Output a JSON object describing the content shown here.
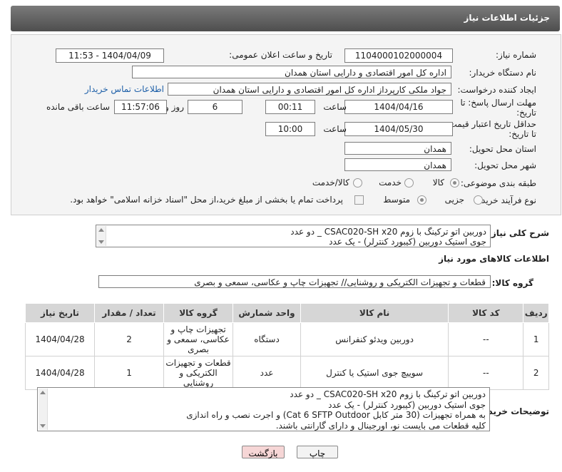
{
  "header": {
    "title": "جزئیات اطلاعات نیاز"
  },
  "form": {
    "need_number_label": "شماره نیاز:",
    "need_number": "1104000102000004",
    "announce_label": "تاریخ و ساعت اعلان عمومی:",
    "announce_value": "1404/04/09 - 11:53",
    "buyer_label": "نام دستگاه خریدار:",
    "buyer_value": "اداره کل امور اقتصادی و دارایی استان همدان",
    "creator_label": "ایجاد کننده درخواست:",
    "creator_value": "جواد ملکی کارپرداز اداره کل امور اقتصادی و دارایی استان همدان",
    "contact_link": "اطلاعات تماس خریدار",
    "deadline_label": "مهلت ارسال پاسخ: تا تاریخ:",
    "deadline_date": "1404/04/16",
    "time_label": "ساعت",
    "deadline_time": "00:11",
    "days_value": "6",
    "days_label": "روز و",
    "remaining_time": "11:57:06",
    "remaining_label": "ساعت باقی مانده",
    "validity_label": "حداقل تاریخ اعتبار قیمت: تا تاریخ:",
    "validity_date": "1404/05/30",
    "validity_time": "10:00",
    "province_label": "استان محل تحویل:",
    "province_value": "همدان",
    "city_label": "شهر محل تحویل:",
    "city_value": "همدان",
    "category_label": "طبقه بندی موضوعی:",
    "category_options": [
      "کالا",
      "خدمت",
      "کالا/خدمت"
    ],
    "process_label": "نوع فرآیند خرید :",
    "process_options": [
      "جزیی",
      "متوسط"
    ],
    "payment_note": "پرداخت تمام یا بخشی از مبلغ خرید،از محل \"اسناد خزانه اسلامی\" خواهد بود."
  },
  "summary": {
    "label": "شرح کلی نیاز:",
    "lines": [
      "دوربین اتو ترکینگ با زوم CSAC020-SH x20 _ دو عدد",
      "جوی استیک دوربین (کیبورد کنترلر) - یک عدد"
    ]
  },
  "goods": {
    "section_title": "اطلاعات کالاهای مورد نیاز",
    "group_label": "گروه کالا:",
    "group_value": "قطعات و تجهیزات الکتریکی و روشنایی// تجهیزات چاپ و عکاسی، سمعی و بصری"
  },
  "table": {
    "headers": [
      "ردیف",
      "کد کالا",
      "نام کالا",
      "واحد شمارش",
      "گروه کالا",
      "تعداد / مقدار",
      "تاریخ نیاز"
    ],
    "rows": [
      {
        "row": "1",
        "code": "--",
        "name": "دوربین ویدئو کنفرانس",
        "unit": "دستگاه",
        "group": "تجهیزات چاپ و عکاسی، سمعی و بصری",
        "qty": "2",
        "date": "1404/04/28"
      },
      {
        "row": "2",
        "code": "--",
        "name": "سوییچ جوی استیک یا کنترل",
        "unit": "عدد",
        "group": "قطعات و تجهیزات الکتریکی و روشنایی",
        "qty": "1",
        "date": "1404/04/28"
      }
    ]
  },
  "buyer_notes": {
    "label": "توضیحات خریدار:",
    "lines": [
      "دوربین اتو ترکینگ با زوم CSAC020-SH x20 _ دو عدد",
      "جوی استیک دوربین (کیبورد کنترلر) - یک عدد",
      "به همراه تجهیزات (30 متر کابل Cat 6 SFTP Outdoor) و اجرت نصب و راه اندازی",
      "کلیه قطعات می بایست نو، اورجینال و دارای گارانتی باشند."
    ]
  },
  "buttons": {
    "print": "چاپ",
    "back": "بازگشت"
  },
  "watermark": "AriaTender.neT"
}
